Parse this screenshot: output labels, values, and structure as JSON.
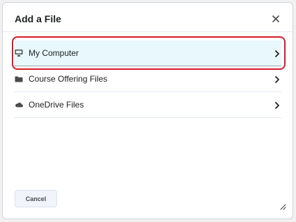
{
  "dialog": {
    "title": "Add a File",
    "close_icon": "close-icon"
  },
  "sources": [
    {
      "label": "My Computer",
      "icon": "computer-icon",
      "selected": true
    },
    {
      "label": "Course Offering Files",
      "icon": "folder-icon",
      "selected": false
    },
    {
      "label": "OneDrive Files",
      "icon": "cloud-icon",
      "selected": false
    }
  ],
  "footer": {
    "cancel_label": "Cancel",
    "resize_icon": "resize-grip-icon"
  },
  "colors": {
    "selected_bg": "#e8f8fd",
    "highlight_border": "#d7192a"
  }
}
